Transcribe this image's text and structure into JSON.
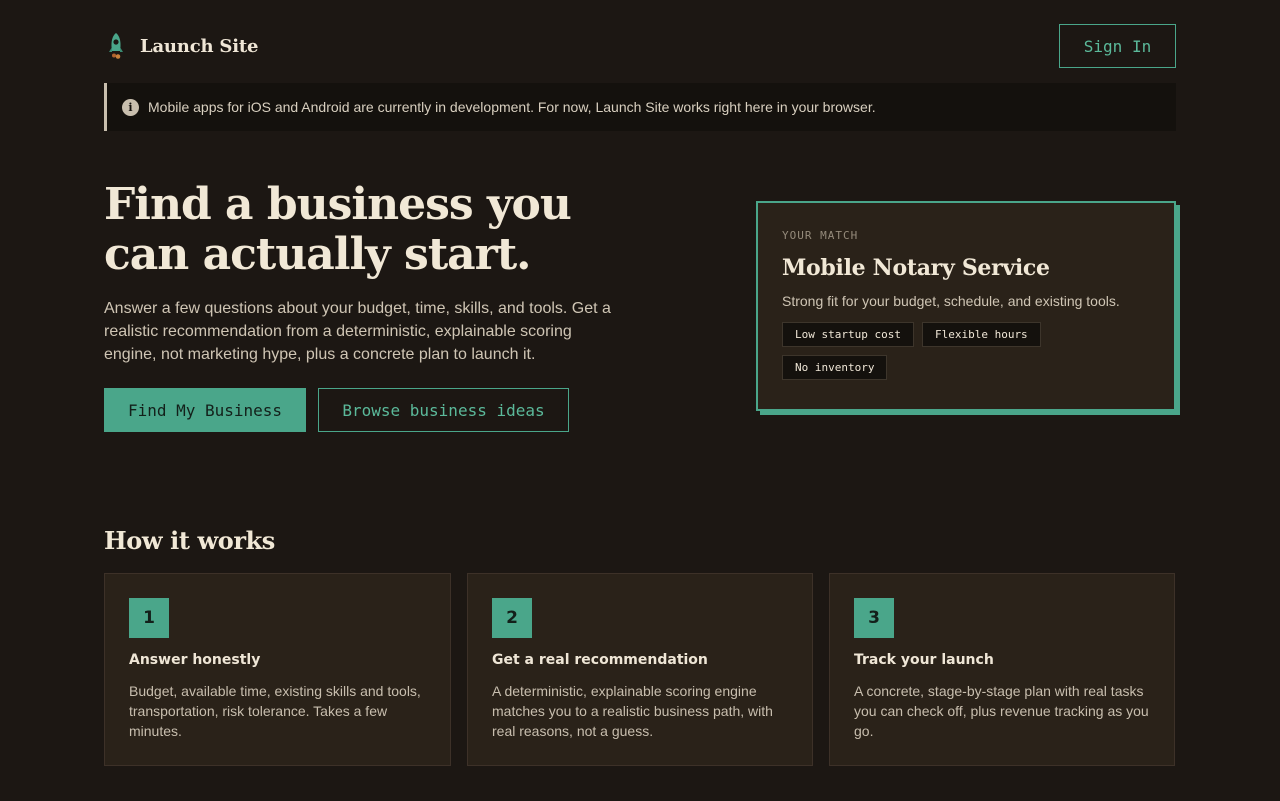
{
  "header": {
    "brand_name": "Launch Site",
    "brand_icon": "rocket-icon",
    "signin_label": "Sign In"
  },
  "notice": {
    "icon": "info-icon",
    "icon_glyph": "i",
    "text": "Mobile apps for iOS and Android are currently in development. For now, Launch Site works right here in your browser."
  },
  "hero": {
    "title": "Find a business you can actually start.",
    "subtitle": "Answer a few questions about your budget, time, skills, and tools. Get a realistic recommendation from a deterministic, explainable scoring engine, not marketing hype, plus a concrete plan to launch it.",
    "primary_cta": "Find My Business",
    "secondary_cta": "Browse business ideas"
  },
  "match": {
    "eyebrow": "YOUR MATCH",
    "title": "Mobile Notary Service",
    "description": "Strong fit for your budget, schedule, and existing tools.",
    "tags": [
      "Low startup cost",
      "Flexible hours",
      "No inventory"
    ]
  },
  "how": {
    "title": "How it works",
    "steps": [
      {
        "number": "1",
        "title": "Answer honestly",
        "description": "Budget, available time, existing skills and tools, transportation, risk tolerance. Takes a few minutes."
      },
      {
        "number": "2",
        "title": "Get a real recommendation",
        "description": "A deterministic, explainable scoring engine matches you to a realistic business path, with real reasons, not a guess."
      },
      {
        "number": "3",
        "title": "Track your launch",
        "description": "A concrete, stage-by-stage plan with real tasks you can check off, plus revenue tracking as you go."
      }
    ]
  },
  "colors": {
    "background": "#1c1713",
    "accent": "#4aa68a",
    "card": "#2a2219",
    "text": "#efe6d6"
  }
}
